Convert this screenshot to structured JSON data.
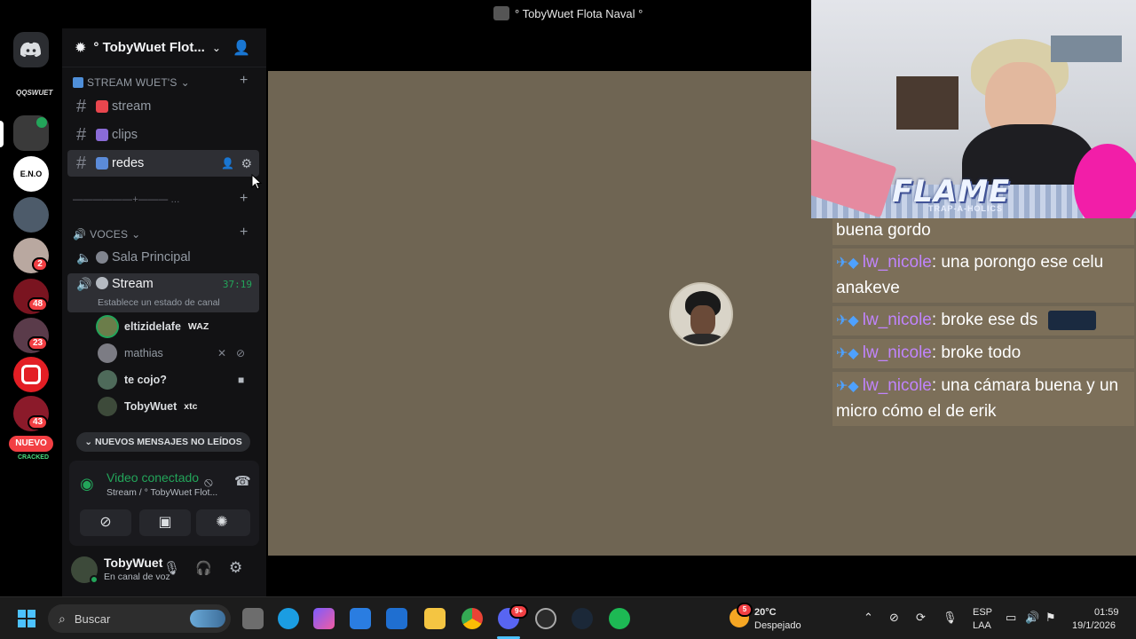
{
  "window": {
    "title": "° TobyWuet Flota Naval °"
  },
  "server": {
    "name": "° TobyWuet Flot..."
  },
  "rail": {
    "top_label": "QQSWUET",
    "badges": [
      "2",
      "48",
      "23",
      "43"
    ],
    "new_label": "NUEVO",
    "bottom_label": "CRACKED"
  },
  "categories": {
    "stream": "STREAM WUET'S",
    "divider": "——————+——— ...",
    "voces": "VOCES"
  },
  "text_channels": [
    {
      "name": "stream"
    },
    {
      "name": "clips"
    },
    {
      "name": "redes"
    }
  ],
  "voice_channels": {
    "sala": "Sala Principal",
    "stream": {
      "name": "Stream",
      "timer": "37:19",
      "status": "Establece un estado de canal"
    }
  },
  "voice_users": [
    {
      "name": "eltizidelafe",
      "tag": "WAZ"
    },
    {
      "name": "mathias",
      "tag": ""
    },
    {
      "name": "te cojo?",
      "tag": ""
    },
    {
      "name": "TobyWuet",
      "tag": "xtc"
    }
  ],
  "new_messages_label": "NUEVOS MENSAJES NO LEÍDOS",
  "voice_panel": {
    "status": "Video conectado",
    "location": "Stream / ° TobyWuet Flot..."
  },
  "userbar": {
    "name": "TobyWuet",
    "status": "En canal de voz"
  },
  "overlay": {
    "brand": "FLAME",
    "brand_sub": "TRAP-A-HOLICS"
  },
  "chat": [
    {
      "user": "",
      "text": "buena gordo"
    },
    {
      "user": "lw_nicole",
      "text": ": una porongo ese celu anakeve"
    },
    {
      "user": "lw_nicole",
      "text": ": broke ese ds"
    },
    {
      "user": "lw_nicole",
      "text": ": broke todo"
    },
    {
      "user": "lw_nicole",
      "text": ": una cámara buena y un micro cómo el de erik"
    }
  ],
  "taskbar": {
    "search_placeholder": "Buscar",
    "discord_badge": "9+",
    "weather_temp": "20°C",
    "weather_desc": "Despejado",
    "weather_badge": "5",
    "lang1": "ESP",
    "lang2": "LAA",
    "time": "01:59",
    "date": "19/1/2026"
  },
  "colors": {
    "accent_green": "#23a55a",
    "stage": "#6f6553",
    "chat_user": "#c084fc"
  }
}
